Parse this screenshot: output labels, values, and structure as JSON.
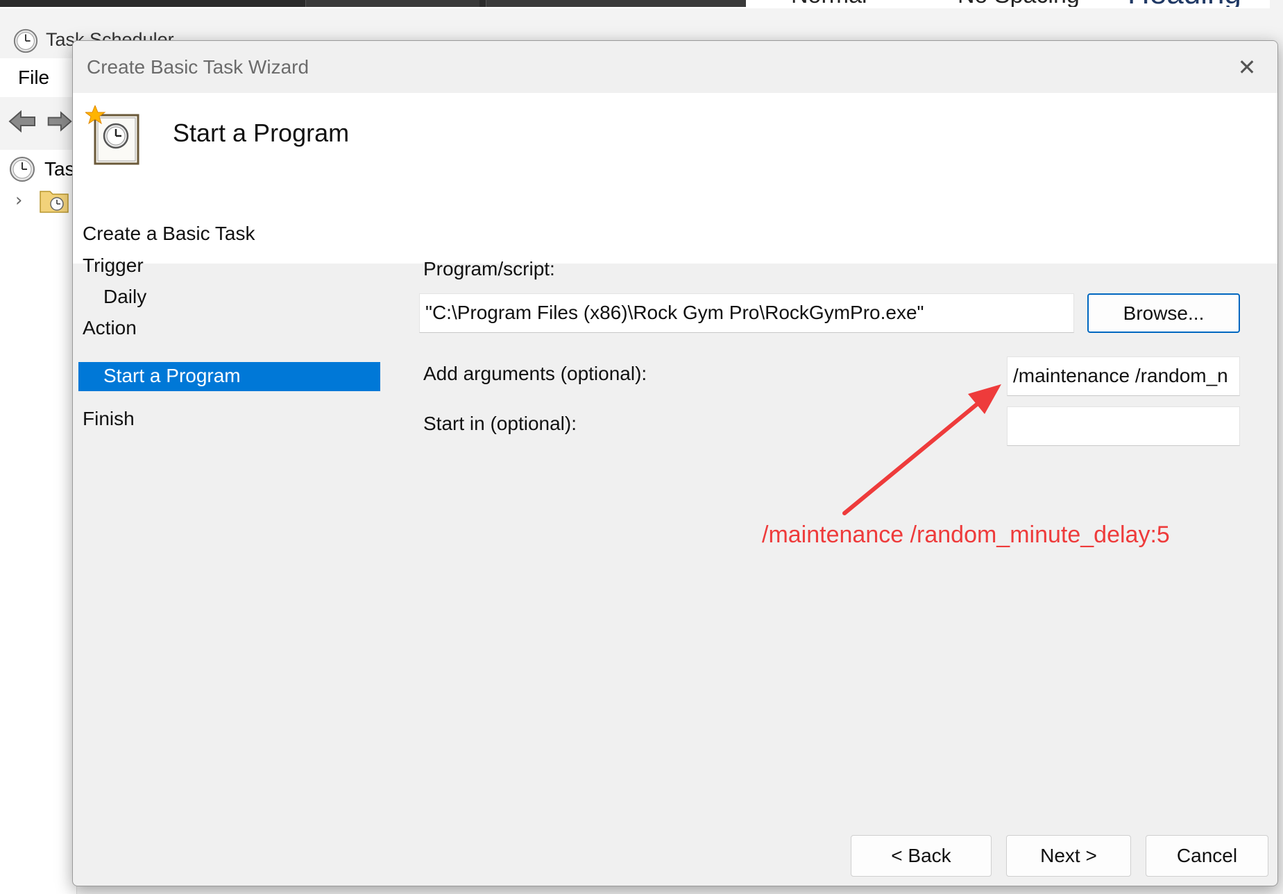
{
  "background_app": {
    "title": "Task Scheduler",
    "menu_file": "File",
    "tree_item": "Tas",
    "styles": [
      "Normal",
      "No Spacing",
      "Heading"
    ]
  },
  "dialog": {
    "title": "Create Basic Task Wizard",
    "header_title": "Start a Program"
  },
  "steps": [
    {
      "label": "Create a Basic Task"
    },
    {
      "label": "Trigger"
    },
    {
      "label": "Daily"
    },
    {
      "label": "Action"
    },
    {
      "label": "Start a Program",
      "selected": true
    },
    {
      "label": "Finish"
    }
  ],
  "form": {
    "program_label": "Program/script:",
    "program_value": "\"C:\\Program Files (x86)\\Rock Gym Pro\\RockGymPro.exe\"",
    "browse_label": "Browse...",
    "arguments_label": "Add arguments (optional):",
    "arguments_value": "/maintenance  /random_n",
    "startin_label": "Start in (optional):",
    "startin_value": ""
  },
  "buttons": {
    "back": "< Back",
    "next": "Next >",
    "cancel": "Cancel"
  },
  "annotation": {
    "text": "/maintenance  /random_minute_delay:5",
    "color": "#ee3b3b"
  },
  "colors": {
    "selection": "#0078d7",
    "primary_border": "#0067c0"
  },
  "icons": [
    "clock-icon",
    "back-arrow-icon",
    "forward-arrow-icon",
    "chevron-right-icon",
    "folder-clock-icon",
    "task-wizard-icon",
    "close-icon"
  ]
}
